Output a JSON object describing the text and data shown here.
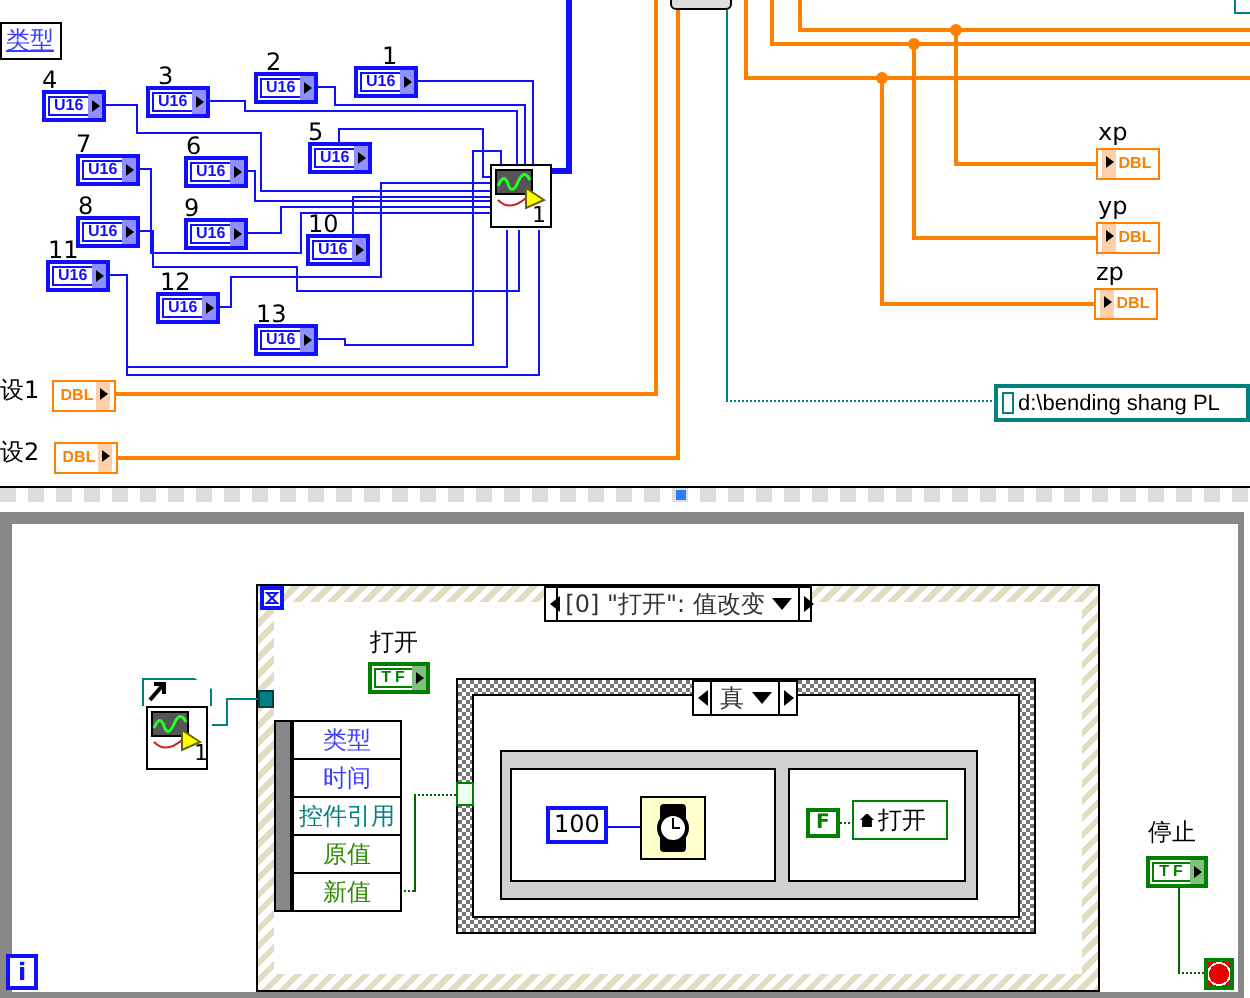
{
  "upper_diagram": {
    "type_label": "类型",
    "u16_constants": [
      {
        "label": "4",
        "type": "U16"
      },
      {
        "label": "3",
        "type": "U16"
      },
      {
        "label": "2",
        "type": "U16"
      },
      {
        "label": "1",
        "type": "U16"
      },
      {
        "label": "7",
        "type": "U16"
      },
      {
        "label": "6",
        "type": "U16"
      },
      {
        "label": "5",
        "type": "U16"
      },
      {
        "label": "8",
        "type": "U16"
      },
      {
        "label": "9",
        "type": "U16"
      },
      {
        "label": "10",
        "type": "U16"
      },
      {
        "label": "11",
        "type": "U16"
      },
      {
        "label": "12",
        "type": "U16"
      },
      {
        "label": "13",
        "type": "U16"
      }
    ],
    "subvi_number": "1",
    "dbl_controls": [
      {
        "label": "设1",
        "type": "DBL"
      },
      {
        "label": "设2",
        "type": "DBL"
      }
    ],
    "dbl_indicators": [
      {
        "label": "xp",
        "type": "DBL"
      },
      {
        "label": "yp",
        "type": "DBL"
      },
      {
        "label": "zp",
        "type": "DBL"
      }
    ],
    "path_constant": "d:\\bending shang PL"
  },
  "lower_diagram": {
    "reference_number": "1",
    "event_selector": "[0] \"打开\": 值改变",
    "open_control": {
      "label": "打开",
      "type": "TF"
    },
    "event_data": [
      {
        "label": "类型",
        "color": "#3c3cff"
      },
      {
        "label": "时间",
        "color": "#3c3cff"
      },
      {
        "label": "控件引用",
        "color": "#008080"
      },
      {
        "label": "原值",
        "color": "#2e8b00"
      },
      {
        "label": "新值",
        "color": "#2e8b00"
      }
    ],
    "case_selector": "真",
    "wait_constant": "100",
    "false_constant": "F",
    "property_node": "打开",
    "stop_control": {
      "label": "停止",
      "type": "TF"
    },
    "iteration_terminal": "i"
  }
}
